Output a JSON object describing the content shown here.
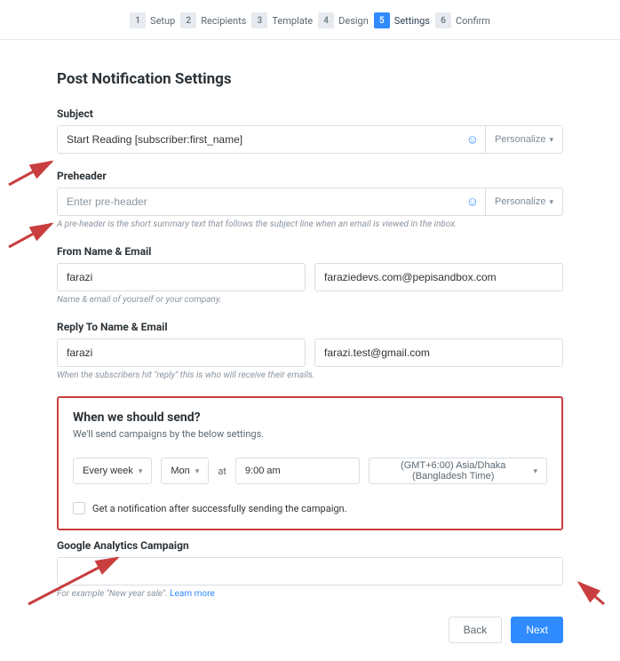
{
  "steps": [
    {
      "num": "1",
      "label": "Setup"
    },
    {
      "num": "2",
      "label": "Recipients"
    },
    {
      "num": "3",
      "label": "Template"
    },
    {
      "num": "4",
      "label": "Design"
    },
    {
      "num": "5",
      "label": "Settings"
    },
    {
      "num": "6",
      "label": "Confirm"
    }
  ],
  "active_step_index": 4,
  "title": "Post Notification Settings",
  "subject": {
    "label": "Subject",
    "value": "Start Reading [subscriber:first_name]",
    "personalize": "Personalize"
  },
  "preheader": {
    "label": "Preheader",
    "placeholder": "Enter pre-header",
    "help": "A pre-header is the short summary text that follows the subject line when an email is viewed in the inbox.",
    "personalize": "Personalize"
  },
  "from": {
    "label": "From Name & Email",
    "name": "farazi",
    "email": "faraziedevs.com@pepisandbox.com",
    "help": "Name & email of yourself or your company."
  },
  "reply": {
    "label": "Reply To Name & Email",
    "name": "farazi",
    "email": "farazi.test@gmail.com",
    "help": "When the subscribers hit \"reply\" this is who will receive their emails."
  },
  "send": {
    "title": "When we should send?",
    "desc": "We'll send campaigns by the below settings.",
    "freq": "Every week",
    "day": "Mon",
    "at": "at",
    "time": "9:00 am",
    "tz": "(GMT+6:00) Asia/Dhaka (Bangladesh Time)",
    "notify": "Get a notification after successfully sending the campaign."
  },
  "ga": {
    "label": "Google Analytics Campaign",
    "help_prefix": "For example \"New year sale\". ",
    "learn_more": "Learn more"
  },
  "buttons": {
    "back": "Back",
    "next": "Next"
  }
}
